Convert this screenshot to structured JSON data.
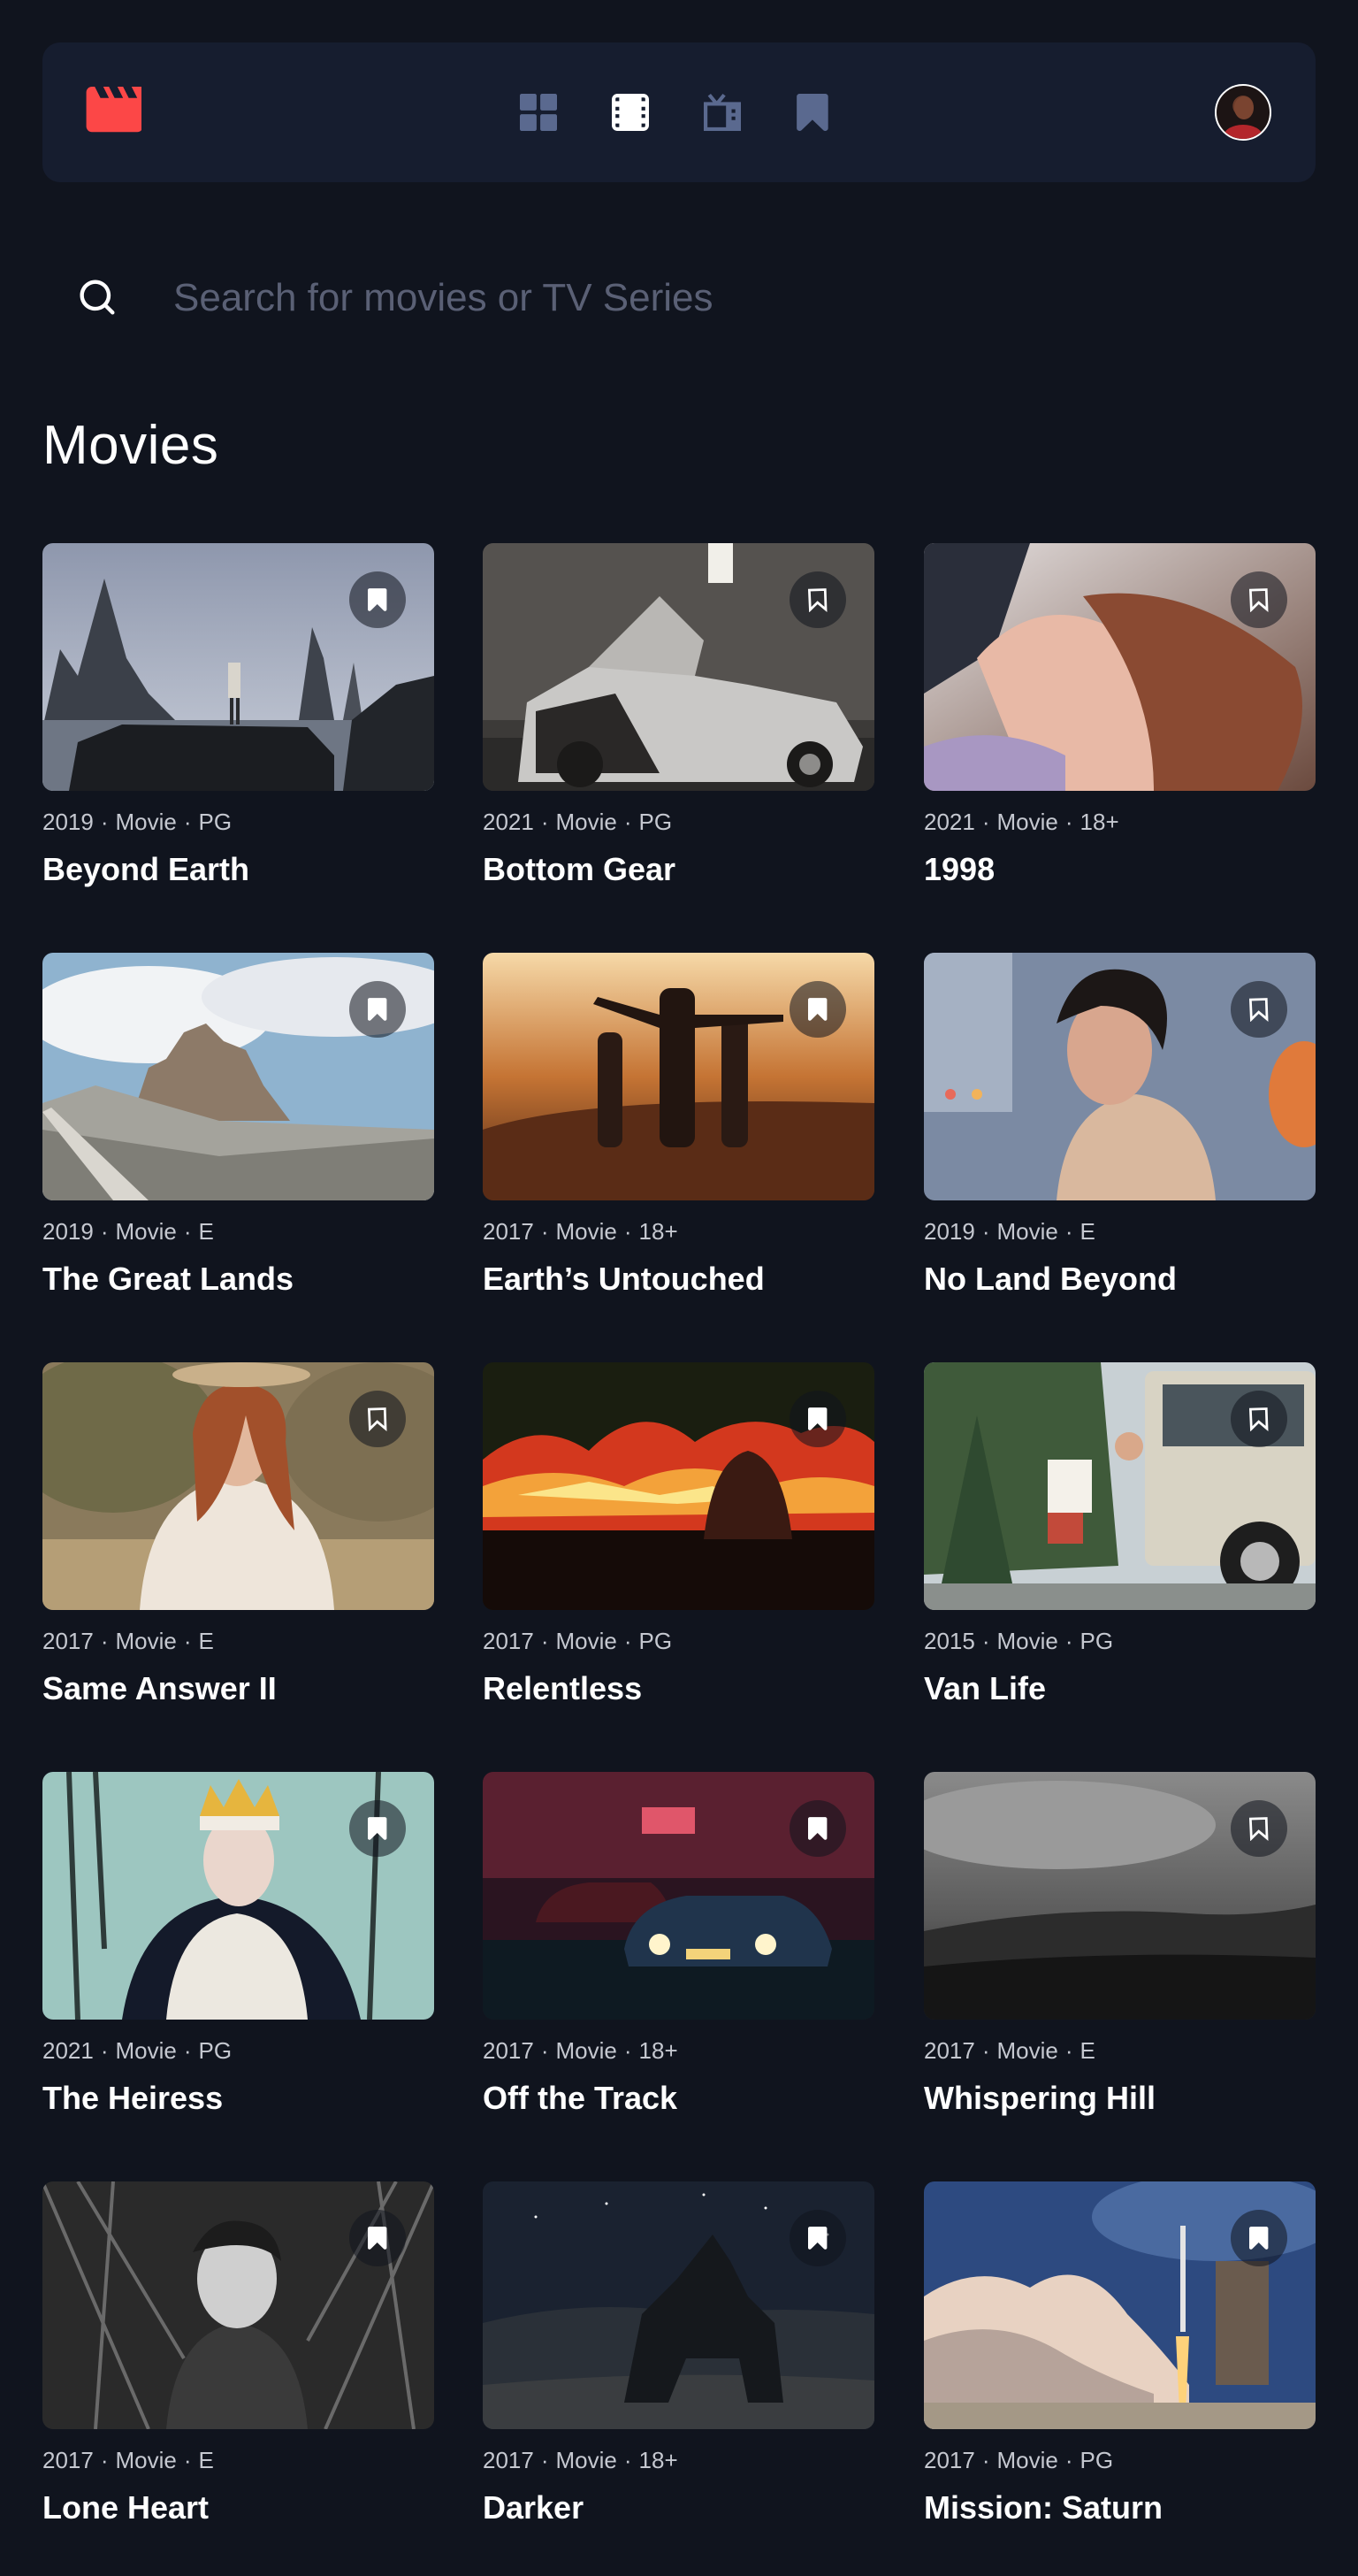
{
  "nav": {
    "logo": {
      "icon": "clapperboard-icon",
      "color": "#fc4747"
    },
    "items": [
      {
        "name": "home",
        "icon": "grid-icon",
        "active": false
      },
      {
        "name": "movies",
        "icon": "film-icon",
        "active": true
      },
      {
        "name": "tv-series",
        "icon": "tv-icon",
        "active": false
      },
      {
        "name": "bookmarks",
        "icon": "bookmark-icon",
        "active": false
      }
    ],
    "avatar": "avatar"
  },
  "search": {
    "placeholder": "Search for movies or TV Series",
    "value": ""
  },
  "section": {
    "title": "Movies"
  },
  "movies": [
    {
      "year": "2019",
      "category": "Movie",
      "rating": "PG",
      "title": "Beyond Earth",
      "bookmarked": true
    },
    {
      "year": "2021",
      "category": "Movie",
      "rating": "PG",
      "title": "Bottom Gear",
      "bookmarked": false
    },
    {
      "year": "2021",
      "category": "Movie",
      "rating": "18+",
      "title": "1998",
      "bookmarked": false
    },
    {
      "year": "2019",
      "category": "Movie",
      "rating": "E",
      "title": "The Great Lands",
      "bookmarked": true
    },
    {
      "year": "2017",
      "category": "Movie",
      "rating": "18+",
      "title": "Earth’s Untouched",
      "bookmarked": true
    },
    {
      "year": "2019",
      "category": "Movie",
      "rating": "E",
      "title": "No Land Beyond",
      "bookmarked": false
    },
    {
      "year": "2017",
      "category": "Movie",
      "rating": "E",
      "title": "Same Answer II",
      "bookmarked": false
    },
    {
      "year": "2017",
      "category": "Movie",
      "rating": "PG",
      "title": "Relentless",
      "bookmarked": true
    },
    {
      "year": "2015",
      "category": "Movie",
      "rating": "PG",
      "title": "Van Life",
      "bookmarked": false
    },
    {
      "year": "2021",
      "category": "Movie",
      "rating": "PG",
      "title": "The Heiress",
      "bookmarked": true
    },
    {
      "year": "2017",
      "category": "Movie",
      "rating": "18+",
      "title": "Off the Track",
      "bookmarked": true
    },
    {
      "year": "2017",
      "category": "Movie",
      "rating": "E",
      "title": "Whispering Hill",
      "bookmarked": false
    },
    {
      "year": "2017",
      "category": "Movie",
      "rating": "E",
      "title": "Lone Heart",
      "bookmarked": true
    },
    {
      "year": "2017",
      "category": "Movie",
      "rating": "18+",
      "title": "Darker",
      "bookmarked": true
    },
    {
      "year": "2017",
      "category": "Movie",
      "rating": "PG",
      "title": "Mission: Saturn",
      "bookmarked": true
    }
  ],
  "colors": {
    "background": "#10141e",
    "surface": "#161d2f",
    "accent": "#fc4747",
    "nav_inactive": "#5a698f",
    "nav_active": "#ffffff"
  }
}
